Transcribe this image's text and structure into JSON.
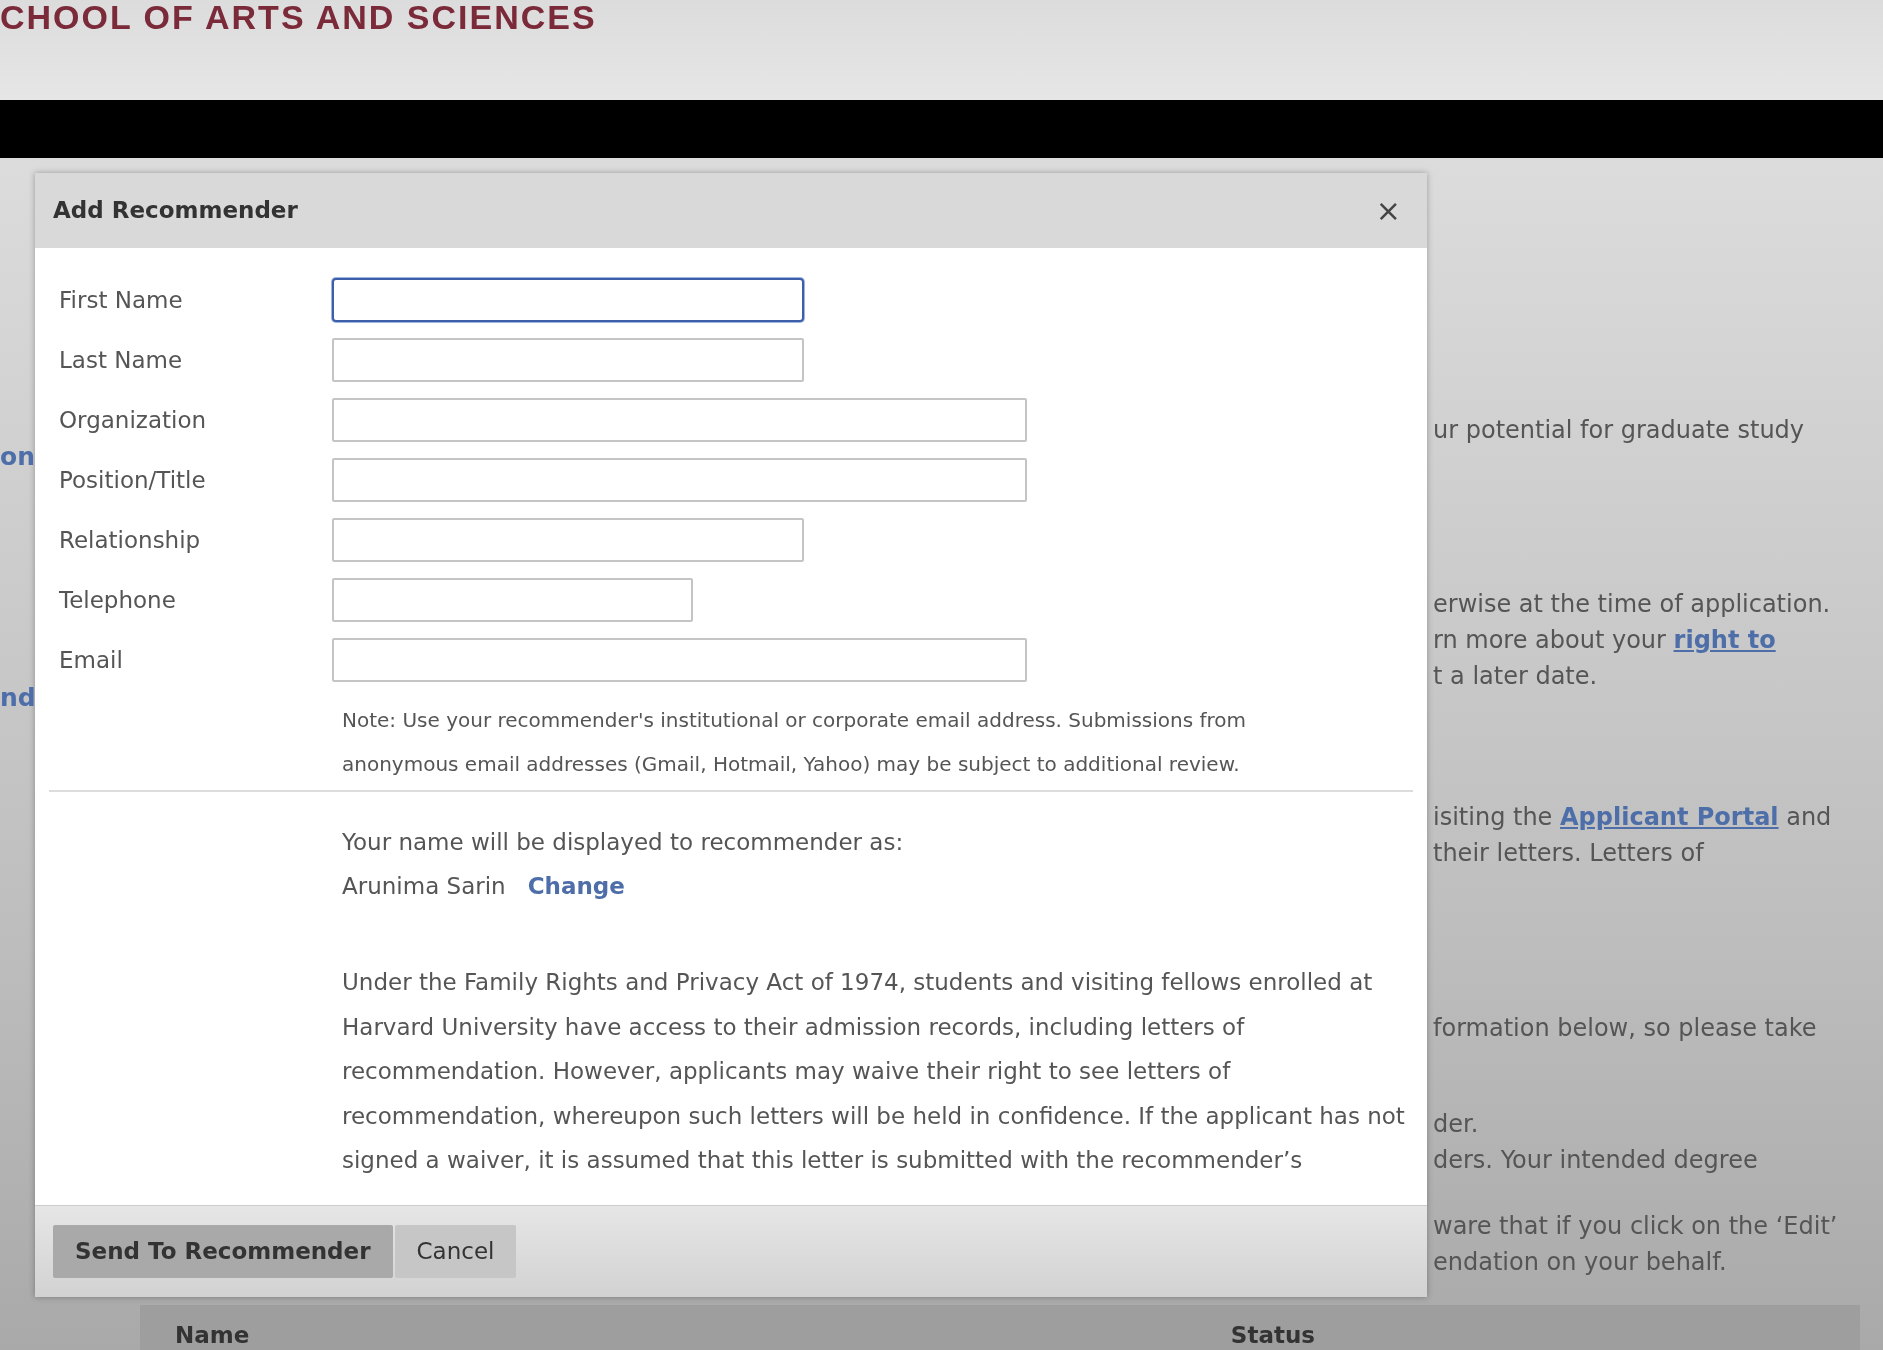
{
  "header": {
    "title": "CHOOL OF ARTS AND SCIENCES"
  },
  "background": {
    "left_fragments": [
      "on",
      "nd"
    ],
    "right_groups": [
      [
        [
          {
            "text": "ur potential for graduate study",
            "kind": "text"
          }
        ]
      ],
      [
        [
          {
            "text": "erwise at the time of application.",
            "kind": "text"
          }
        ],
        [
          {
            "text": "rn more about your ",
            "kind": "text"
          },
          {
            "text": "right to",
            "kind": "link"
          }
        ],
        [
          {
            "text": "t a later date.",
            "kind": "text"
          }
        ]
      ],
      [
        [
          {
            "text": "isiting the ",
            "kind": "text"
          },
          {
            "text": "Applicant Portal",
            "kind": "link"
          },
          {
            "text": " and",
            "kind": "text"
          }
        ],
        [
          {
            "text": "their letters. Letters of",
            "kind": "text"
          }
        ]
      ],
      [
        [
          {
            "text": "formation below, so please take",
            "kind": "text"
          }
        ]
      ],
      [
        [
          {
            "text": "der.",
            "kind": "text"
          }
        ],
        [
          {
            "text": "ders. Your intended degree",
            "kind": "text"
          }
        ]
      ],
      [
        [
          {
            "text": "ware that if you click on the ‘Edit’",
            "kind": "text"
          }
        ],
        [
          {
            "text": "endation on your behalf.",
            "kind": "text"
          }
        ]
      ]
    ],
    "table": {
      "columns": [
        "Name",
        "Status"
      ]
    }
  },
  "dialog": {
    "title": "Add Recommender",
    "close": "×",
    "fields": [
      {
        "label": "First Name",
        "kind": "medium",
        "focused": true
      },
      {
        "label": "Last Name",
        "kind": "medium",
        "focused": false
      },
      {
        "label": "Organization",
        "kind": "long",
        "focused": false
      },
      {
        "label": "Position/Title",
        "kind": "long",
        "focused": false
      },
      {
        "label": "Relationship",
        "kind": "medium",
        "focused": false
      },
      {
        "label": "Telephone",
        "kind": "short",
        "focused": false
      },
      {
        "label": "Email",
        "kind": "long",
        "focused": false
      }
    ],
    "note": "Note: Use your recommender's institutional or corporate email address. Submissions from anonymous email addresses (Gmail, Hotmail, Yahoo) may be subject to additional review.",
    "display_name": {
      "intro": "Your name will be displayed to recommender as:",
      "name": "Arunima Sarin",
      "change_link": "Change"
    },
    "waiver_text": "Under the Family Rights and Privacy Act of 1974, students and visiting fellows enrolled at Harvard University have access to their admission records, including letters of recommendation. However, applicants may waive their right to see letters of recommendation, whereupon such letters will be held in confidence. If the applicant has not signed a waiver, it is assumed that this letter is submitted with the recommender’s",
    "buttons": [
      {
        "label": "Send To Recommender",
        "kind": "primary"
      },
      {
        "label": "Cancel",
        "kind": "secondary"
      }
    ]
  }
}
